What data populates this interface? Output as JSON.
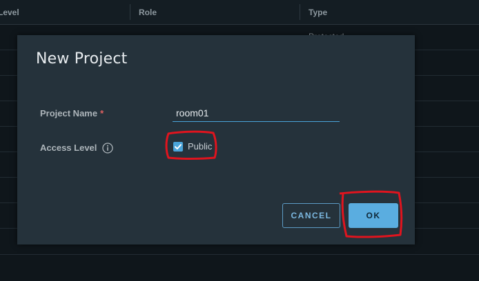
{
  "table": {
    "columns": [
      "Level",
      "Role",
      "Type"
    ],
    "first_row_type": "Protected"
  },
  "dialog": {
    "title": "New Project",
    "project_name_label": "Project Name",
    "required_marker": "*",
    "project_name_value": "room01",
    "access_level_label": "Access Level",
    "public_label": "Public",
    "public_checked": true,
    "cancel_label": "CANCEL",
    "ok_label": "OK"
  },
  "annotation_color": "#e0141e",
  "colors": {
    "accent": "#4aa5da",
    "dialog_bg": "#25323b",
    "page_bg": "#0f161b"
  }
}
